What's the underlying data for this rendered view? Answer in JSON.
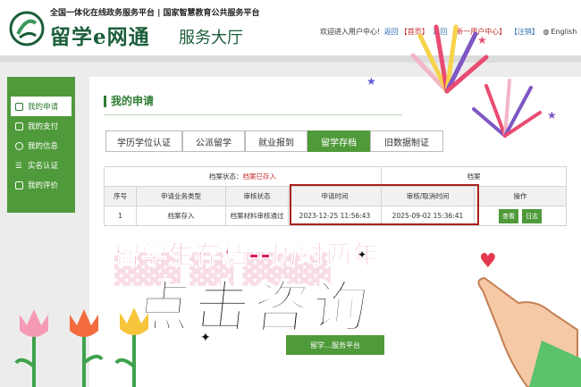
{
  "header": {
    "tagline": "全国一体化在线政务服务平台 | 国家智慧教育公共服务平台",
    "logo_main": "留学e网通",
    "logo_sub": "服务大厅",
    "welcome": "欢迎进入用户中心!",
    "link_back": "返回",
    "link_home": "【首页】",
    "link_back2": "返回",
    "link_new_center": "【新一用户中心】",
    "link_logout": "【注销】",
    "link_lang": "English"
  },
  "sidebar": {
    "items": [
      {
        "label": "我的申请",
        "icon": "application-icon",
        "active": true
      },
      {
        "label": "我的支付",
        "icon": "payment-card-icon",
        "active": false
      },
      {
        "label": "我的信息",
        "icon": "user-info-icon",
        "active": false
      },
      {
        "label": "实名认证",
        "icon": "list-verify-icon",
        "active": false
      },
      {
        "label": "我的评价",
        "icon": "edit-review-icon",
        "active": false
      }
    ]
  },
  "main": {
    "section_title": "我的申请",
    "tabs": [
      {
        "label": "学历学位认证",
        "active": false
      },
      {
        "label": "公派留学",
        "active": false
      },
      {
        "label": "就业报到",
        "active": false
      },
      {
        "label": "留学存档",
        "active": true
      },
      {
        "label": "旧数据制证",
        "active": false
      }
    ],
    "status_prefix": "档案状态：",
    "status_value": "档案已存入",
    "status_right": "档案",
    "table": {
      "headers": [
        "序号",
        "申请业务类型",
        "审核状态",
        "申请时间",
        "审核/取消时间",
        "操作"
      ],
      "rows": [
        {
          "no": "1",
          "type": "档案存入",
          "status": "档案材料审核通过",
          "apply_time": "2023-12-25 11:56:43",
          "review_time": "2025-09-02 15:36:41",
          "actions": [
            "查看",
            "日志"
          ]
        }
      ]
    }
  },
  "overlay": {
    "headline": "留学生存档--历时两年",
    "cta": "点击咨询",
    "hall_button": "留学…服务平台"
  },
  "colors": {
    "brand_green": "#4f9a3a",
    "highlight_red": "#a8201a",
    "headline_pink": "#d81b60"
  }
}
